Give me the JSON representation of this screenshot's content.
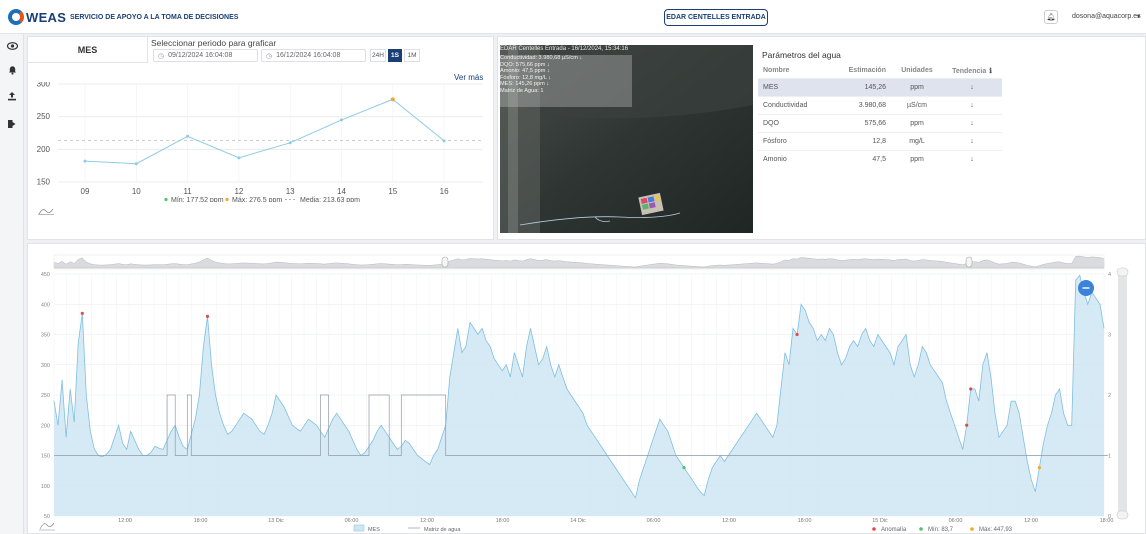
{
  "header": {
    "logo_text": "WEAS",
    "subtitle": "SERVICIO DE APOYO A LA TOMA DE DECISIONES",
    "station": "EDAR CENTELLES ENTRADA",
    "user": "dosona@aquacorp.es",
    "user_caret": "▾"
  },
  "sidebar": {
    "icons": [
      "eye-icon",
      "bell-icon",
      "upload-icon",
      "logout-icon"
    ]
  },
  "selector": {
    "parameter": "MES",
    "period_title": "Seleccionar periodo para graficar",
    "date_from": "09/12/2024 16:04:08",
    "date_to": "16/12/2024 16:04:08",
    "ranges": [
      "24H",
      "1S",
      "1M"
    ],
    "active_range": "1S",
    "ver_mas": "Ver más"
  },
  "camera": {
    "title": "EDAR Centelles Entrada - 16/12/2024, 15:34:16",
    "readings": [
      "Conductividad: 3.980,68 µS/cm ↓",
      "DQO: 575,66 ppm ↓",
      "Amonio: 47,5 ppm ↓",
      "Fósforo: 12,8 mg/L ↓",
      "MES: 145,26 ppm ↓",
      "Matriz de Agua: 1"
    ]
  },
  "params": {
    "title": "Parámetros del agua",
    "headers": [
      "Nombre",
      "Estimación",
      "Unidades",
      "Tendencia"
    ],
    "rows": [
      {
        "name": "MES",
        "value": "145,26",
        "unit": "ppm",
        "trend": "↓"
      },
      {
        "name": "Conductividad",
        "value": "3.980,68",
        "unit": "µS/cm",
        "trend": "↓"
      },
      {
        "name": "DQO",
        "value": "575,66",
        "unit": "ppm",
        "trend": "↓"
      },
      {
        "name": "Fósforo",
        "value": "12,8",
        "unit": "mg/L",
        "trend": "↓"
      },
      {
        "name": "Amonio",
        "value": "47,5",
        "unit": "ppm",
        "trend": "↓"
      }
    ]
  },
  "colors": {
    "series": "#8fcbe6",
    "fill": "#cfe6f3",
    "min": "#4fc46b",
    "max": "#f2a72a",
    "anomaly": "#e24b4b",
    "navy": "#1a3f74"
  },
  "chart_data": [
    {
      "type": "line",
      "x": [
        "09",
        "10",
        "11",
        "12",
        "13",
        "14",
        "15",
        "16"
      ],
      "values": [
        182,
        178,
        220,
        187,
        210,
        245,
        276.5,
        213
      ],
      "ylim": [
        150,
        300
      ],
      "yticks": [
        150,
        200,
        250,
        300
      ],
      "mean": 213.63,
      "grid": true,
      "legend": {
        "min": "Mín: 177,52 ppm",
        "max": "Máx: 276,5 ppm",
        "mean": "Media: 213,63 ppm"
      }
    },
    {
      "type": "area",
      "ylim": [
        50,
        450
      ],
      "yticks": [
        50,
        100,
        150,
        200,
        250,
        300,
        350,
        400,
        450
      ],
      "y2lim": [
        0,
        4
      ],
      "y2ticks": [
        0,
        1,
        2,
        3,
        4
      ],
      "xticks": [
        "12:00",
        "18:00",
        "13 Dic",
        "06:00",
        "12:00",
        "18:00",
        "14 Dic",
        "06:00",
        "12:00",
        "18:00",
        "15 Dic",
        "06:00",
        "12:00",
        "18:00"
      ],
      "n": 252,
      "mes": [
        240,
        200,
        275,
        180,
        260,
        205,
        335,
        385,
        250,
        190,
        160,
        150,
        148,
        152,
        160,
        180,
        200,
        170,
        160,
        190,
        175,
        160,
        150,
        150,
        155,
        165,
        162,
        160,
        175,
        190,
        200,
        180,
        165,
        160,
        185,
        210,
        250,
        330,
        380,
        300,
        250,
        220,
        200,
        185,
        190,
        200,
        210,
        220,
        215,
        210,
        200,
        190,
        185,
        200,
        220,
        250,
        240,
        230,
        215,
        200,
        195,
        190,
        200,
        210,
        205,
        200,
        190,
        180,
        195,
        210,
        220,
        210,
        200,
        190,
        175,
        160,
        150,
        155,
        165,
        175,
        190,
        200,
        190,
        180,
        170,
        160,
        165,
        175,
        170,
        160,
        150,
        145,
        140,
        135,
        150,
        160,
        180,
        200,
        280,
        320,
        360,
        320,
        330,
        370,
        360,
        350,
        360,
        340,
        330,
        310,
        300,
        290,
        300,
        280,
        320,
        300,
        280,
        330,
        360,
        330,
        300,
        310,
        330,
        300,
        280,
        300,
        280,
        260,
        250,
        240,
        230,
        220,
        200,
        190,
        180,
        170,
        160,
        150,
        140,
        130,
        120,
        110,
        100,
        90,
        80,
        110,
        130,
        150,
        170,
        190,
        210,
        200,
        190,
        170,
        150,
        140,
        130,
        120,
        110,
        100,
        90,
        83.7,
        110,
        130,
        140,
        150,
        140,
        150,
        160,
        170,
        180,
        190,
        200,
        210,
        220,
        210,
        200,
        190,
        180,
        200,
        260,
        320,
        300,
        360,
        350,
        400,
        390,
        370,
        360,
        340,
        350,
        340,
        360,
        350,
        320,
        300,
        310,
        330,
        340,
        330,
        350,
        360,
        340,
        330,
        350,
        340,
        330,
        320,
        300,
        330,
        340,
        350,
        300,
        280,
        300,
        330,
        320,
        300,
        290,
        280,
        270,
        240,
        220,
        200,
        180,
        160,
        200,
        260,
        260,
        240,
        300,
        320,
        280,
        220,
        180,
        190,
        200,
        240,
        240,
        220,
        180,
        140,
        110,
        90,
        130,
        170,
        200,
        220,
        250,
        260,
        220,
        200,
        200,
        440,
        447.93,
        420,
        400,
        420,
        410,
        400,
        360
      ],
      "matriz": [
        1,
        1,
        1,
        1,
        1,
        1,
        1,
        1,
        1,
        1,
        1,
        1,
        1,
        1,
        1,
        1,
        1,
        1,
        1,
        1,
        1,
        1,
        1,
        1,
        1,
        1,
        1,
        1,
        2,
        2,
        1,
        1,
        1,
        2,
        1,
        1,
        1,
        1,
        1,
        1,
        1,
        1,
        1,
        1,
        1,
        1,
        1,
        1,
        1,
        1,
        1,
        1,
        1,
        1,
        1,
        1,
        1,
        1,
        1,
        1,
        1,
        1,
        1,
        1,
        1,
        1,
        2,
        2,
        1,
        1,
        1,
        1,
        1,
        1,
        1,
        1,
        1,
        1,
        2,
        2,
        2,
        2,
        2,
        1,
        1,
        1,
        2,
        2,
        2,
        2,
        2,
        2,
        2,
        2,
        2,
        2,
        2,
        1,
        1,
        1,
        1,
        1,
        1,
        1,
        1,
        1,
        1,
        1,
        1,
        1,
        1,
        1,
        1,
        1,
        1,
        1,
        1,
        1,
        1,
        1,
        1,
        1,
        1,
        1,
        1,
        1,
        1,
        1,
        1,
        1,
        1,
        1,
        1,
        1,
        1,
        1,
        1,
        1,
        1,
        1,
        1,
        1,
        1,
        1,
        1,
        1,
        1,
        1,
        1,
        1,
        1,
        1,
        1,
        1,
        1,
        1,
        1,
        1,
        1,
        1,
        1,
        1,
        1,
        1,
        1,
        1,
        1,
        1,
        1,
        1,
        1,
        1,
        1,
        1,
        1,
        1,
        1,
        1,
        1,
        1,
        1,
        1,
        1,
        1,
        1,
        1,
        1,
        1,
        1,
        1,
        1,
        1,
        1,
        1,
        1,
        1,
        1,
        1,
        1,
        1,
        1,
        1,
        1,
        1,
        1,
        1,
        1,
        1,
        1,
        1,
        1,
        1,
        1,
        1,
        1,
        1,
        1,
        1,
        1,
        1,
        1,
        1,
        1,
        1,
        1,
        1,
        1,
        1,
        1,
        1,
        1,
        1,
        1,
        1,
        1,
        1,
        1,
        1,
        1,
        1,
        1,
        1,
        1,
        1,
        1,
        1,
        1,
        1,
        1,
        1,
        1,
        1,
        1,
        1,
        1,
        1,
        1,
        1,
        1,
        1,
        1,
        1
      ],
      "anomalies": [
        7,
        38,
        184,
        226,
        227
      ],
      "min_index": 156,
      "max_index": 244,
      "legend": {
        "series": "MES",
        "matriz": "Matriz de agua",
        "anomaly": "Anomalía",
        "min": "Mín: 83,7",
        "max": "Máx: 447,93"
      }
    }
  ]
}
